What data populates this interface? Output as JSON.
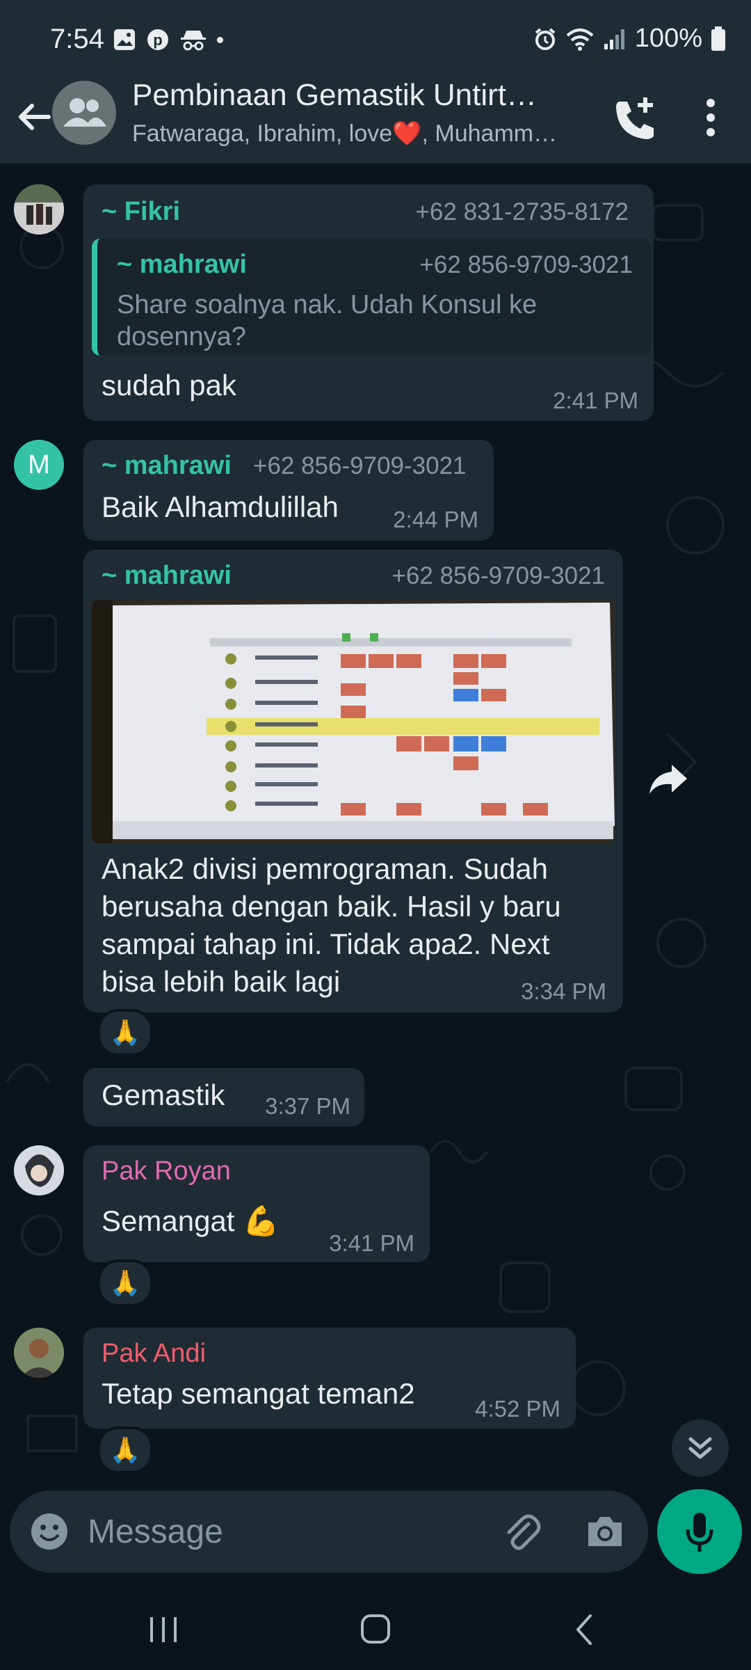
{
  "status_bar": {
    "time": "7:54",
    "battery": "100%"
  },
  "header": {
    "title": "Pembinaan Gemastik Untirt…",
    "subtitle": "Fatwaraga, Ibrahim, love❤️, Muhamm…"
  },
  "messages": [
    {
      "sender": "~ Fikri",
      "phone": "+62 831-2735-8172",
      "quote": {
        "sender": "~ mahrawi",
        "phone": "+62 856-9709-3021",
        "text": "Share soalnya nak. Udah Konsul ke dosennya?"
      },
      "text": "sudah pak",
      "time": "2:41 PM"
    },
    {
      "avatar_letter": "M",
      "sender": "~ mahrawi",
      "phone": "+62 856-9709-3021",
      "text": "Baik Alhamdulillah",
      "time": "2:44 PM"
    },
    {
      "sender": "~ mahrawi",
      "phone": "+62 856-9709-3021",
      "lines": [
        "Anak2 divisi pemrograman. Sudah",
        "berusaha dengan baik. Hasil y baru",
        "sampai tahap ini. Tidak apa2. Next",
        "bisa lebih baik lagi"
      ],
      "time": "3:34 PM",
      "reaction": "🙏"
    },
    {
      "text": "Gemastik",
      "time": "3:37 PM"
    },
    {
      "sender": "Pak Royan",
      "text": "Semangat 💪",
      "time": "3:41 PM",
      "reaction": "🙏"
    },
    {
      "sender": "Pak Andi",
      "text": "Tetap semangat teman2",
      "time": "4:52 PM",
      "reaction": "🙏"
    }
  ],
  "composer": {
    "placeholder": "Message"
  },
  "colors": {
    "background": "#0b141a",
    "bubble": "#202c33",
    "accent_green": "#00a884",
    "teal_name": "#34c3a6",
    "pink_name": "#e26ab3",
    "red_name": "#f15c6d"
  }
}
